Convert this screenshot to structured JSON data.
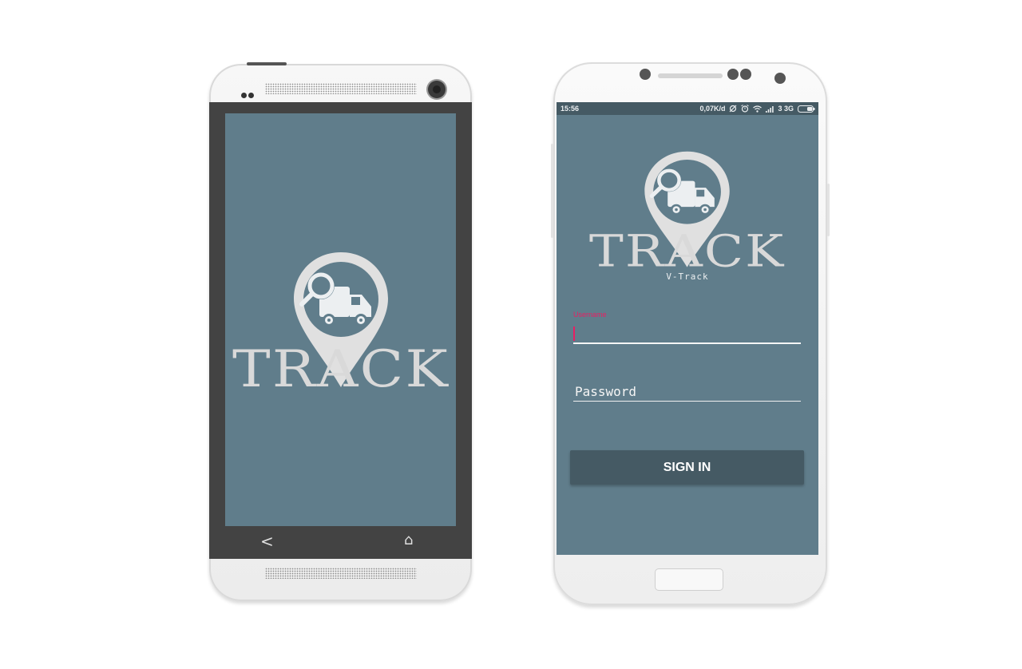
{
  "splash_phone": {
    "logo_text": "TRACK",
    "nav": {
      "back_icon": "back-chevron-icon",
      "home_icon": "home-icon"
    }
  },
  "login_phone": {
    "status_bar": {
      "time": "15:56",
      "network_speed": "0,07K/d",
      "network_type": "3 3G",
      "icons": [
        "sync-off-icon",
        "alarm-icon",
        "wifi-icon",
        "signal-icon",
        "battery-icon"
      ]
    },
    "logo_text": "TRACK",
    "app_name": "V-Track",
    "username": {
      "label": "Username",
      "value": ""
    },
    "password": {
      "placeholder": "Password",
      "value": ""
    },
    "sign_in_label": "SIGN IN"
  },
  "colors": {
    "screen_bg": "#607d8b",
    "status_bar_bg": "#455a64",
    "button_bg": "#455a64",
    "accent": "#e91e63",
    "logo_light": "#e0e0e0",
    "logo_pin_inner": "#eceff1"
  }
}
